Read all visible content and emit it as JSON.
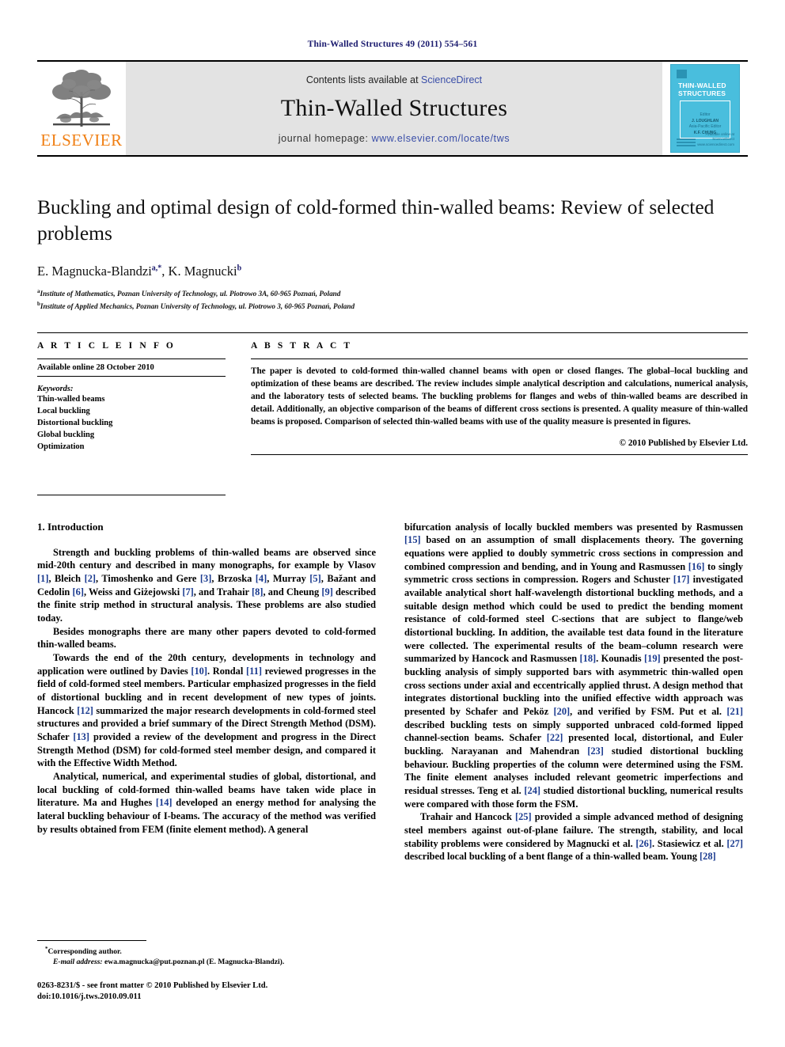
{
  "running_head": "Thin-Walled Structures 49 (2011) 554–561",
  "banner": {
    "contents_prefix": "Contents lists available at",
    "sciencedirect": "ScienceDirect",
    "journal_title": "Thin-Walled Structures",
    "homepage_prefix": "journal homepage:",
    "homepage_url": "www.elsevier.com/locate/tws",
    "publisher_logo_text": "ELSEVIER",
    "logo_icon": "elsevier-tree-icon",
    "cover": {
      "title_line1": "THIN-WALLED",
      "title_line2": "STRUCTURES",
      "editor_label": "Editor",
      "editor_name": "J. LOUGHLAN",
      "assoc_label": "Asia-Pacific Editor",
      "assoc_name": "K.F. CHUNG",
      "footer_note": "Available online at",
      "footer_brand": "ScienceDirect",
      "footer_sub": "www.sciencedirect.com"
    },
    "accent_blue": "#3a4ea8",
    "elsevier_orange": "#F07F13",
    "cover_cyan": "#49bedd"
  },
  "article": {
    "title": "Buckling and optimal design of cold-formed thin-walled beams: Review of selected problems",
    "authors_html": "E. Magnucka-Blandzi, K. Magnucki",
    "author1": "E. Magnucka-Blandzi",
    "author1_sup": "a,*",
    "author2": "K. Magnucki",
    "author2_sup": "b",
    "affiliation_a_sup": "a",
    "affiliation_a": "Institute of Mathematics, Poznan University of Technology, ul. Piotrowo 3A, 60-965 Poznań, Poland",
    "affiliation_b_sup": "b",
    "affiliation_b": "Institute of Applied Mechanics, Poznan University of Technology, ul. Piotrowo 3, 60-965 Poznań, Poland"
  },
  "article_info": {
    "heading": "A R T I C L E    I N F O",
    "available_online": "Available online 28 October 2010",
    "keywords_label": "Keywords:",
    "keywords": [
      "Thin-walled beams",
      "Local buckling",
      "Distortional buckling",
      "Global buckling",
      "Optimization"
    ]
  },
  "abstract": {
    "heading": "A B S T R A C T",
    "text": "The paper is devoted to cold-formed thin-walled channel beams with open or closed flanges. The global–local buckling and optimization of these beams are described. The review includes simple analytical description and calculations, numerical analysis, and the laboratory tests of selected beams. The buckling problems for flanges and webs of thin-walled beams are described in detail. Additionally, an objective comparison of the beams of different cross sections is presented. A quality measure of thin-walled beams is proposed. Comparison of selected thin-walled beams with use of the quality measure is presented in figures.",
    "copyright": "© 2010 Published by Elsevier Ltd."
  },
  "body": {
    "section_title": "1. Introduction",
    "left_paragraphs": [
      {
        "indent": true,
        "parts": [
          {
            "t": "Strength and buckling problems of thin-walled beams are observed since mid-20th century and described in many monographs, for example by Vlasov "
          },
          {
            "t": "[1]",
            "ref": true
          },
          {
            "t": ", Bleich "
          },
          {
            "t": "[2]",
            "ref": true
          },
          {
            "t": ", Timoshenko and Gere "
          },
          {
            "t": "[3]",
            "ref": true
          },
          {
            "t": ", Brzoska "
          },
          {
            "t": "[4]",
            "ref": true
          },
          {
            "t": ", Murray "
          },
          {
            "t": "[5]",
            "ref": true
          },
          {
            "t": ", Bažant and Cedolin "
          },
          {
            "t": "[6]",
            "ref": true
          },
          {
            "t": ", Weiss and Giżejowski "
          },
          {
            "t": "[7]",
            "ref": true
          },
          {
            "t": ", and Trahair "
          },
          {
            "t": "[8]",
            "ref": true
          },
          {
            "t": ", and Cheung "
          },
          {
            "t": "[9]",
            "ref": true
          },
          {
            "t": " described the finite strip method in structural analysis. These problems are also studied today."
          }
        ]
      },
      {
        "indent": true,
        "parts": [
          {
            "t": "Besides monographs there are many other papers devoted to cold-formed thin-walled beams."
          }
        ]
      },
      {
        "indent": true,
        "parts": [
          {
            "t": "Towards the end of the 20th century, developments in technology and application were outlined by Davies "
          },
          {
            "t": "[10]",
            "ref": true
          },
          {
            "t": ". Rondal "
          },
          {
            "t": "[11]",
            "ref": true
          },
          {
            "t": " reviewed progresses in the field of cold-formed steel members. Particular emphasized progresses in the field of distortional buckling and in recent development of new types of joints. Hancock "
          },
          {
            "t": "[12]",
            "ref": true
          },
          {
            "t": " summarized the major research developments in cold-formed steel structures and provided a brief summary of the Direct Strength Method (DSM). Schafer "
          },
          {
            "t": "[13]",
            "ref": true
          },
          {
            "t": " provided a review of the development and progress in the Direct Strength Method (DSM) for cold-formed steel member design, and compared it with the Effective Width Method."
          }
        ]
      },
      {
        "indent": true,
        "parts": [
          {
            "t": "Analytical, numerical, and experimental studies of global, distortional, and local buckling of cold-formed thin-walled beams have taken wide place in literature. Ma and Hughes "
          },
          {
            "t": "[14]",
            "ref": true
          },
          {
            "t": " developed an energy method for analysing the lateral buckling behaviour of I-beams. The accuracy of the method was verified by results obtained from FEM (finite element method). A general"
          }
        ]
      }
    ],
    "right_paragraphs": [
      {
        "indent": false,
        "parts": [
          {
            "t": "bifurcation analysis of locally buckled members was presented by Rasmussen "
          },
          {
            "t": "[15]",
            "ref": true
          },
          {
            "t": " based on an assumption of small displacements theory. The governing equations were applied to doubly symmetric cross sections in compression and combined compression and bending, and in Young and Rasmussen "
          },
          {
            "t": "[16]",
            "ref": true
          },
          {
            "t": " to singly symmetric cross sections in compression. Rogers and Schuster "
          },
          {
            "t": "[17]",
            "ref": true
          },
          {
            "t": " investigated available analytical short half-wavelength distortional buckling methods, and a suitable design method which could be used to predict the bending moment resistance of cold-formed steel C-sections that are subject to flange/web distortional buckling. In addition, the available test data found in the literature were collected. The experimental results of the beam–column research were summarized by Hancock and Rasmussen "
          },
          {
            "t": "[18]",
            "ref": true
          },
          {
            "t": ". Kounadis "
          },
          {
            "t": "[19]",
            "ref": true
          },
          {
            "t": " presented the post-buckling analysis of simply supported bars with asymmetric thin-walled open cross sections under axial and eccentrically applied thrust. A design method that integrates distortional buckling into the unified effective width approach was presented by Schafer and Peköz "
          },
          {
            "t": "[20]",
            "ref": true
          },
          {
            "t": ", and verified by FSM. Put et al. "
          },
          {
            "t": "[21]",
            "ref": true
          },
          {
            "t": " described buckling tests on simply supported unbraced cold-formed lipped channel-section beams. Schafer "
          },
          {
            "t": "[22]",
            "ref": true
          },
          {
            "t": " presented local, distortional, and Euler buckling. Narayanan and Mahendran "
          },
          {
            "t": "[23]",
            "ref": true
          },
          {
            "t": " studied distortional buckling behaviour. Buckling properties of the column were determined using the FSM. The finite element analyses included relevant geometric imperfections and residual stresses. Teng et al. "
          },
          {
            "t": "[24]",
            "ref": true
          },
          {
            "t": " studied distortional buckling, numerical results were compared with those form the FSM."
          }
        ]
      },
      {
        "indent": true,
        "parts": [
          {
            "t": "Trahair and Hancock "
          },
          {
            "t": "[25]",
            "ref": true
          },
          {
            "t": " provided a simple advanced method of designing steel members against out-of-plane failure. The strength, stability, and local stability problems were considered by Magnucki et al. "
          },
          {
            "t": "[26]",
            "ref": true
          },
          {
            "t": ". Stasiewicz et al. "
          },
          {
            "t": "[27]",
            "ref": true
          },
          {
            "t": " described local buckling of a bent flange of a thin-walled beam. Young "
          },
          {
            "t": "[28]",
            "ref": true
          }
        ]
      }
    ]
  },
  "footnotes": {
    "corresponding_marker": "*",
    "corresponding_text": "Corresponding author.",
    "email_label": "E-mail address:",
    "email_value": "ewa.magnucka@put.poznan.pl (E. Magnucka-Blandzi).",
    "issn_line": "0263-8231/$ - see front matter © 2010 Published by Elsevier Ltd.",
    "doi_line": "doi:10.1016/j.tws.2010.09.011"
  }
}
